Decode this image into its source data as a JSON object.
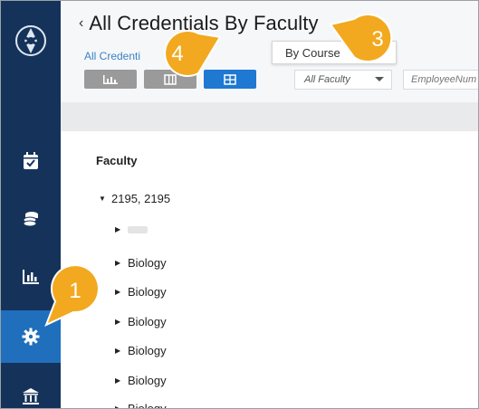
{
  "header": {
    "back_glyph": "‹",
    "title": "All Credentials By Faculty",
    "title_caret": "⌄",
    "breadcrumb": "All Credenti"
  },
  "view_menu": {
    "option_by_course": "By Course"
  },
  "filters": {
    "faculty_select_value": "All Faculty",
    "employee_placeholder": "EmployeeNum"
  },
  "tree": {
    "header": "Faculty",
    "root": {
      "expander": "▼",
      "label": "2195, 2195"
    },
    "children": [
      {
        "expander": "▶",
        "label": ""
      },
      {
        "expander": "▶",
        "label": "Biology"
      },
      {
        "expander": "▶",
        "label": "Biology"
      },
      {
        "expander": "▶",
        "label": "Biology"
      },
      {
        "expander": "▶",
        "label": "Biology"
      },
      {
        "expander": "▶",
        "label": "Biology"
      },
      {
        "expander": "▶",
        "label": "Biology"
      }
    ]
  },
  "callouts": [
    "1",
    "3",
    "4"
  ],
  "colors": {
    "sidebar": "#15335a",
    "sidebar_active": "#1f6fbd",
    "callout": "#f2a91f",
    "link": "#3b82c4"
  },
  "icons": [
    "logo-icon",
    "calendar-check-icon",
    "coins-icon",
    "bar-chart-icon",
    "gear-icon",
    "institution-icon",
    "chart-view-icon",
    "table-view-icon",
    "grid-view-icon"
  ]
}
